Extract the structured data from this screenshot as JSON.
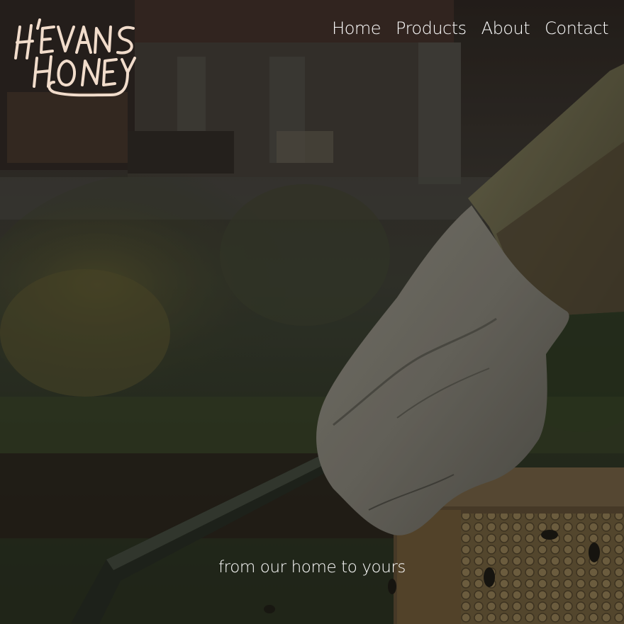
{
  "brand": {
    "logo_text": "H'EVANS HONEY",
    "logo_color": "#f1dccb"
  },
  "nav": {
    "items": [
      {
        "label": "Home"
      },
      {
        "label": "Products"
      },
      {
        "label": "About"
      },
      {
        "label": "Contact"
      }
    ]
  },
  "hero": {
    "background_description_icon": "beekeeper-glove-photo",
    "tagline": "from our home to yours",
    "overlay_color": "#000000"
  }
}
